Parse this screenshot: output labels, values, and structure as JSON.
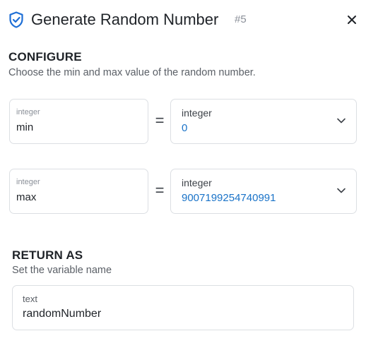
{
  "header": {
    "title": "Generate Random Number",
    "step": "#5",
    "icon": "shield-check-icon",
    "close_icon": "close-icon",
    "accent_color": "#1f6fd6"
  },
  "configure": {
    "title": "CONFIGURE",
    "subtitle": "Choose the min and max value of the random number.",
    "rows": [
      {
        "param_type": "integer",
        "param_name": "min",
        "equals": "=",
        "value_type": "integer",
        "value": "0"
      },
      {
        "param_type": "integer",
        "param_name": "max",
        "equals": "=",
        "value_type": "integer",
        "value": "9007199254740991"
      }
    ]
  },
  "return_as": {
    "title": "RETURN AS",
    "subtitle": "Set the variable name",
    "field_type": "text",
    "field_value": "randomNumber"
  }
}
